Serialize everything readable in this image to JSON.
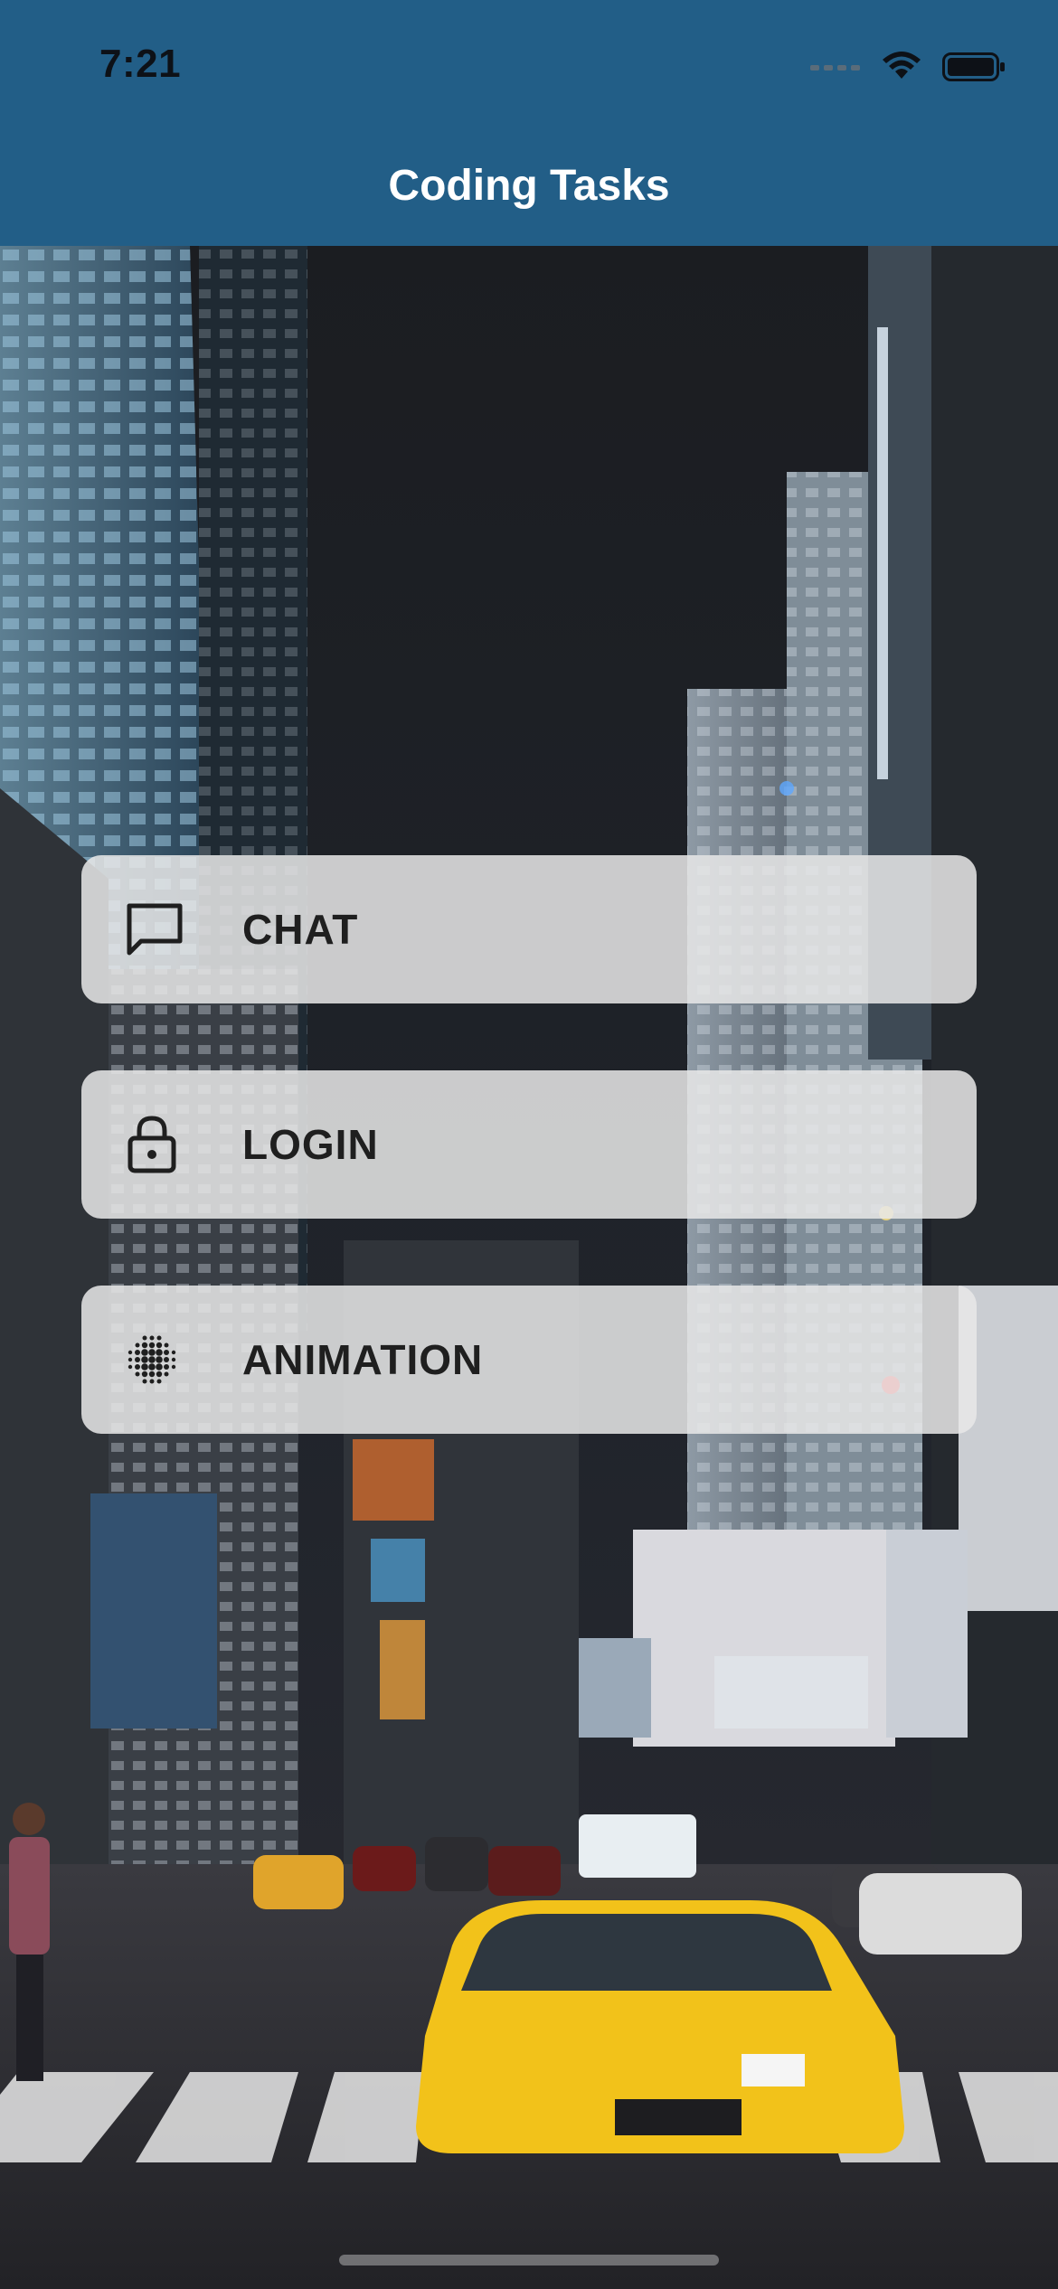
{
  "status_bar": {
    "time": "7:21",
    "icons": [
      "signal-icon",
      "wifi-icon",
      "battery-icon"
    ]
  },
  "nav": {
    "title": "Coding Tasks"
  },
  "menu": {
    "items": [
      {
        "label": "CHAT",
        "icon": "chat-bubble-icon"
      },
      {
        "label": "LOGIN",
        "icon": "lock-icon"
      },
      {
        "label": "ANIMATION",
        "icon": "dot-grid-icon"
      }
    ]
  },
  "colors": {
    "header": "#225e87",
    "button_bg": "#e8e8e8",
    "button_text": "#1f1f1f",
    "title_text": "#ffffff"
  }
}
